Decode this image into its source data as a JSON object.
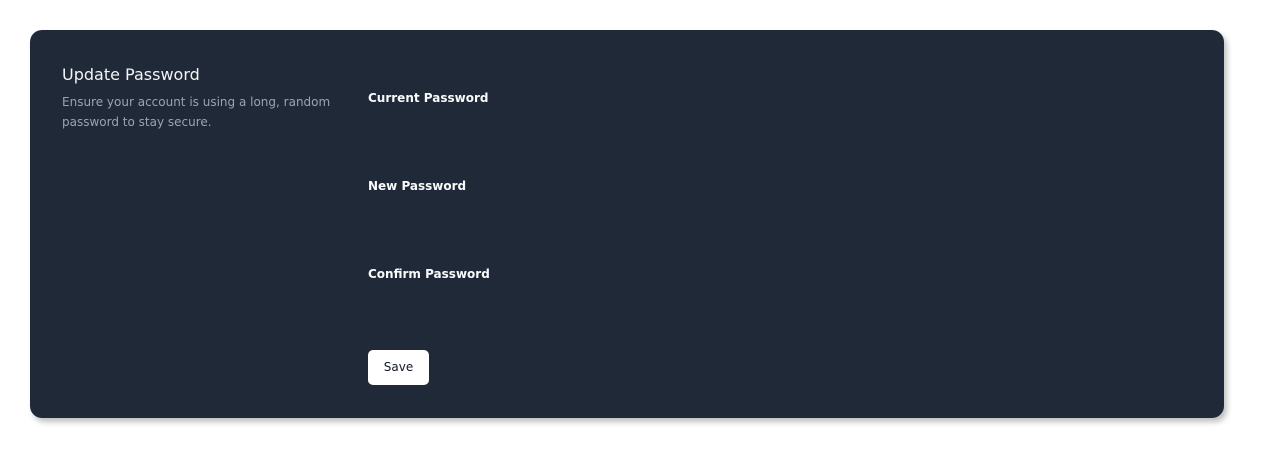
{
  "section": {
    "title": "Update Password",
    "description": "Ensure your account is using a long, random password to stay secure."
  },
  "form": {
    "fields": [
      {
        "label": "Current Password",
        "value": ""
      },
      {
        "label": "New Password",
        "value": ""
      },
      {
        "label": "Confirm Password",
        "value": ""
      }
    ],
    "save_label": "Save"
  },
  "colors": {
    "panel_background": "#1f2937",
    "page_background": "#ffffff",
    "title_text": "#f3f4f6",
    "description_text": "#9ca3af",
    "label_text": "#f9fafb",
    "button_background": "#ffffff",
    "button_text": "#111827"
  }
}
